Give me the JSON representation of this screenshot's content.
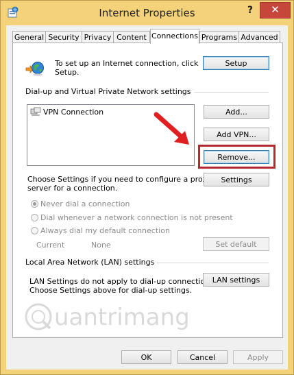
{
  "window": {
    "title": "Internet Properties",
    "help_label": "?",
    "close_label": "✕"
  },
  "tabs": [
    {
      "label": "General"
    },
    {
      "label": "Security"
    },
    {
      "label": "Privacy"
    },
    {
      "label": "Content"
    },
    {
      "label": "Connections"
    },
    {
      "label": "Programs"
    },
    {
      "label": "Advanced"
    }
  ],
  "setup": {
    "text_line1": "To set up an Internet connection, click",
    "text_line2": "Setup.",
    "button_label": "Setup"
  },
  "dialup": {
    "group_label": "Dial-up and Virtual Private Network settings",
    "list_items": [
      {
        "label": "VPN Connection"
      }
    ],
    "add_label": "Add...",
    "add_vpn_label": "Add VPN...",
    "remove_label": "Remove...",
    "choose_text_line1": "Choose Settings if you need to configure a proxy",
    "choose_text_line2": "server for a connection.",
    "settings_label": "Settings",
    "radio_never": "Never dial a connection",
    "radio_whenever": "Dial whenever a network connection is not present",
    "radio_always": "Always dial my default connection",
    "current_label": "Current",
    "current_value": "None",
    "set_default_label": "Set default"
  },
  "lan": {
    "group_label": "Local Area Network (LAN) settings",
    "text_line1": "LAN Settings do not apply to dial-up connections.",
    "text_line2": "Choose Settings above for dial-up settings.",
    "button_label": "LAN settings"
  },
  "footer": {
    "ok_label": "OK",
    "cancel_label": "Cancel",
    "apply_label": "Apply"
  },
  "watermark": {
    "text": "uantrimang"
  },
  "colors": {
    "title_bar": "#f3d27a",
    "close_button": "#c7463c",
    "highlight_box": "#b9262c",
    "arrow": "#e02020",
    "default_button_border": "#3c7fb1"
  }
}
